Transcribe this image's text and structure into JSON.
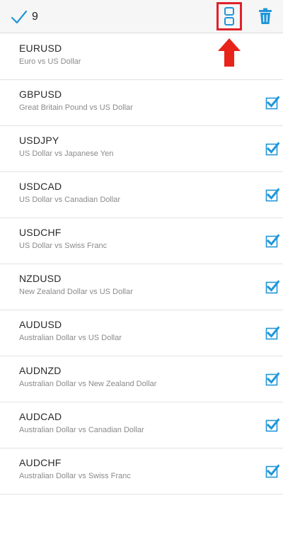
{
  "toolbar": {
    "selected_count": "9",
    "done_icon": "checkmark-icon",
    "symbols_icon": "symbols-view-icon",
    "delete_icon": "trash-icon",
    "highlight_color": "#e0212b",
    "accent_color": "#2196d9"
  },
  "annotation": {
    "arrow_icon": "red-up-arrow-icon",
    "color": "#e8231a"
  },
  "symbols": [
    {
      "symbol": "EURUSD",
      "description": "Euro vs US Dollar",
      "checked": false
    },
    {
      "symbol": "GBPUSD",
      "description": "Great Britain Pound vs US Dollar",
      "checked": true
    },
    {
      "symbol": "USDJPY",
      "description": "US Dollar vs Japanese Yen",
      "checked": true
    },
    {
      "symbol": "USDCAD",
      "description": "US Dollar vs Canadian Dollar",
      "checked": true
    },
    {
      "symbol": "USDCHF",
      "description": "US Dollar vs Swiss Franc",
      "checked": true
    },
    {
      "symbol": "NZDUSD",
      "description": "New Zealand Dollar vs US Dollar",
      "checked": true
    },
    {
      "symbol": "AUDUSD",
      "description": "Australian Dollar vs US Dollar",
      "checked": true
    },
    {
      "symbol": "AUDNZD",
      "description": "Australian Dollar vs New Zealand Dollar",
      "checked": true
    },
    {
      "symbol": "AUDCAD",
      "description": "Australian Dollar vs Canadian Dollar",
      "checked": true
    },
    {
      "symbol": "AUDCHF",
      "description": "Australian Dollar vs Swiss Franc",
      "checked": true
    }
  ]
}
